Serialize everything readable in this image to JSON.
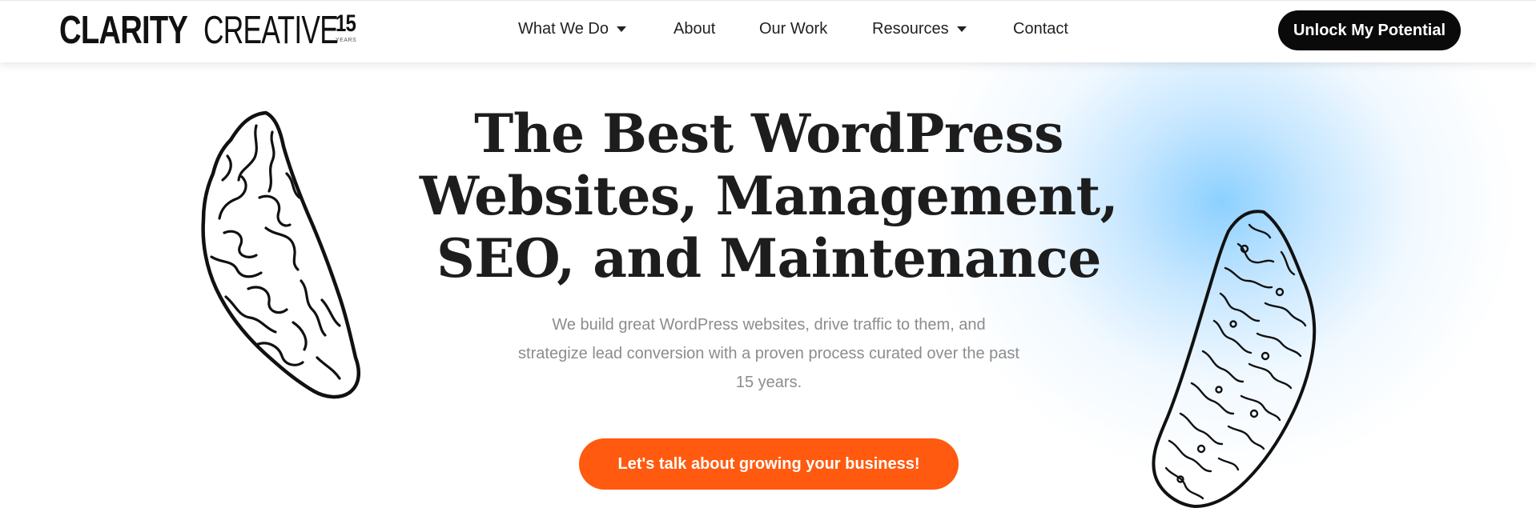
{
  "header": {
    "logo": {
      "bold": "CLARITY",
      "light": "CREATIVE",
      "years_num": "15",
      "years_label": "YEARS"
    },
    "nav": [
      {
        "label": "What We Do",
        "dropdown": true
      },
      {
        "label": "About",
        "dropdown": false
      },
      {
        "label": "Our Work",
        "dropdown": false
      },
      {
        "label": "Resources",
        "dropdown": true
      },
      {
        "label": "Contact",
        "dropdown": false
      }
    ],
    "cta_label": "Unlock My Potential"
  },
  "hero": {
    "title_line1": "The Best WordPress",
    "title_line2": "Websites, Management,",
    "title_line3": "SEO, and Maintenance",
    "subtitle_line1": "We build great WordPress websites, drive traffic to them, and",
    "subtitle_line2": "strategize lead conversion with a proven process curated over the past",
    "subtitle_line3": "15 years.",
    "cta_label": "Let's talk about growing your business!"
  },
  "colors": {
    "accent_orange": "#ff5a0f",
    "header_button": "#0a0a0a",
    "glow_blue": "#78c8ff"
  },
  "icons": [
    "caret-down-icon",
    "brain-illustration"
  ]
}
